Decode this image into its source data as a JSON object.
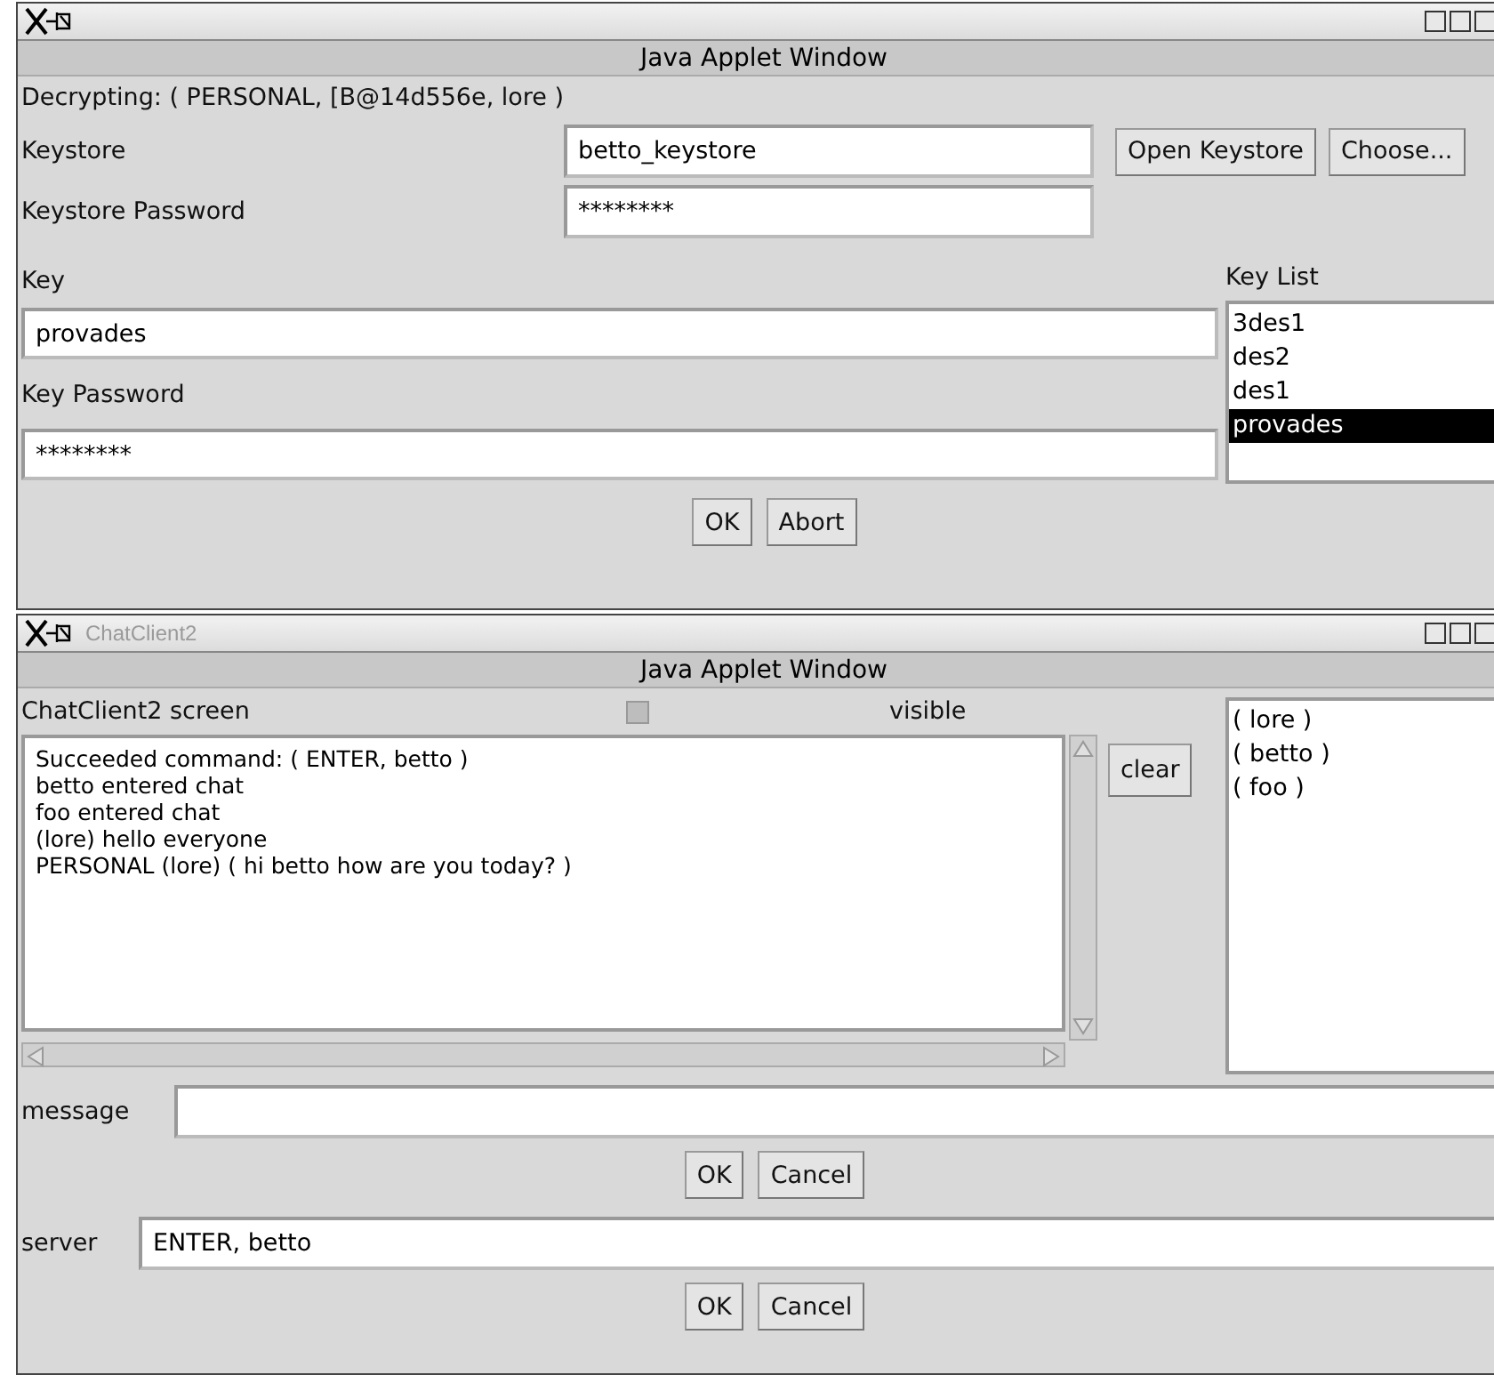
{
  "key_window": {
    "applet_banner": "Java Applet Window",
    "status": "Decrypting: ( PERSONAL, [B@14d556e, lore )",
    "keystore": {
      "label": "Keystore",
      "value": "betto_keystore"
    },
    "keystore_password": {
      "label": "Keystore Password",
      "value": "********"
    },
    "keystore_buttons": [
      "Open Keystore",
      "Choose..."
    ],
    "key": {
      "label": "Key",
      "value": "provades"
    },
    "key_password": {
      "label": "Key Password",
      "value": "********"
    },
    "key_list": {
      "label": "Key List",
      "items": [
        {
          "label": "3des1",
          "selected": false
        },
        {
          "label": "des2",
          "selected": false
        },
        {
          "label": "des1",
          "selected": false
        },
        {
          "label": "provades",
          "selected": true
        }
      ]
    },
    "buttons": [
      "OK",
      "Abort"
    ]
  },
  "chat_window": {
    "title": "ChatClient2",
    "applet_banner": "Java Applet Window",
    "screen_label": "ChatClient2 screen",
    "visible": {
      "label": "visible",
      "checked": false
    },
    "log": [
      "Succeeded command: ( ENTER, betto )",
      "betto entered chat",
      "foo entered chat",
      "(lore) hello everyone",
      "PERSONAL (lore) ( hi betto how are you today? )"
    ],
    "clear_button": "clear",
    "users": [
      "( lore )",
      "( betto )",
      "( foo )"
    ],
    "message": {
      "label": "message"
    },
    "message_buttons": [
      "OK",
      "Cancel"
    ],
    "server": {
      "label": "server",
      "value": "ENTER, betto"
    },
    "server_buttons": [
      "OK",
      "Cancel"
    ]
  }
}
